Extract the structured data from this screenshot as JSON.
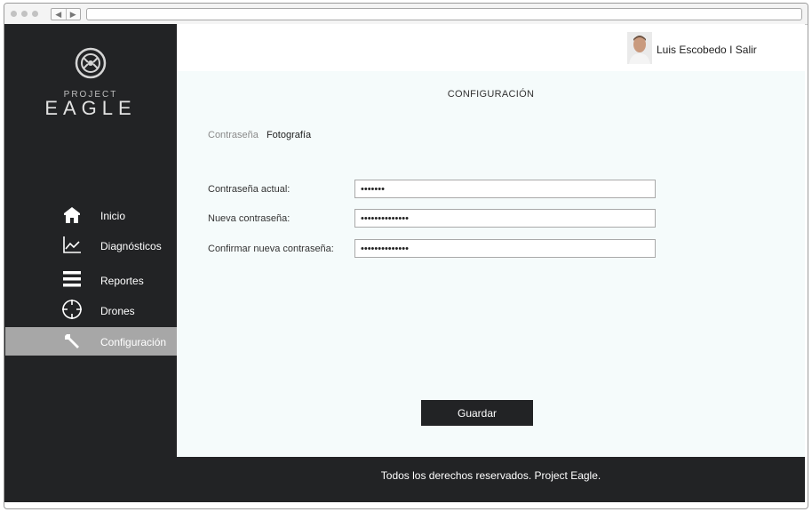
{
  "brand": {
    "line1": "PROJECT",
    "line2": "EAGLE"
  },
  "header": {
    "user_name": "Luis Escobedo",
    "separator": "I",
    "logout": "Salir"
  },
  "sidebar": {
    "items": [
      {
        "label": "Inicio",
        "icon": "home-icon"
      },
      {
        "label": "Diagnósticos",
        "icon": "chart-line-icon"
      },
      {
        "label": "Reportes",
        "icon": "menu-lines-icon"
      },
      {
        "label": "Drones",
        "icon": "crosshair-icon"
      },
      {
        "label": "Configuración",
        "icon": "wrench-icon",
        "active": true
      }
    ]
  },
  "main": {
    "title": "CONFIGURACIÓN",
    "tabs": [
      {
        "label": "Contraseña",
        "active": false
      },
      {
        "label": "Fotografía",
        "active": true
      }
    ],
    "fields": {
      "current_label": "Contraseña actual:",
      "current_value": "•••••••",
      "new_label": "Nueva contraseña:",
      "new_value": "••••••••••••••",
      "confirm_label": "Confirmar nueva contraseña:",
      "confirm_value": "••••••••••••••"
    },
    "save_label": "Guardar"
  },
  "footer": {
    "text": "Todos los derechos reservados. Project Eagle."
  },
  "colors": {
    "sidebar_bg": "#222325",
    "active_item_bg": "#a7a7a7",
    "content_bg": "#f5fbfb"
  }
}
